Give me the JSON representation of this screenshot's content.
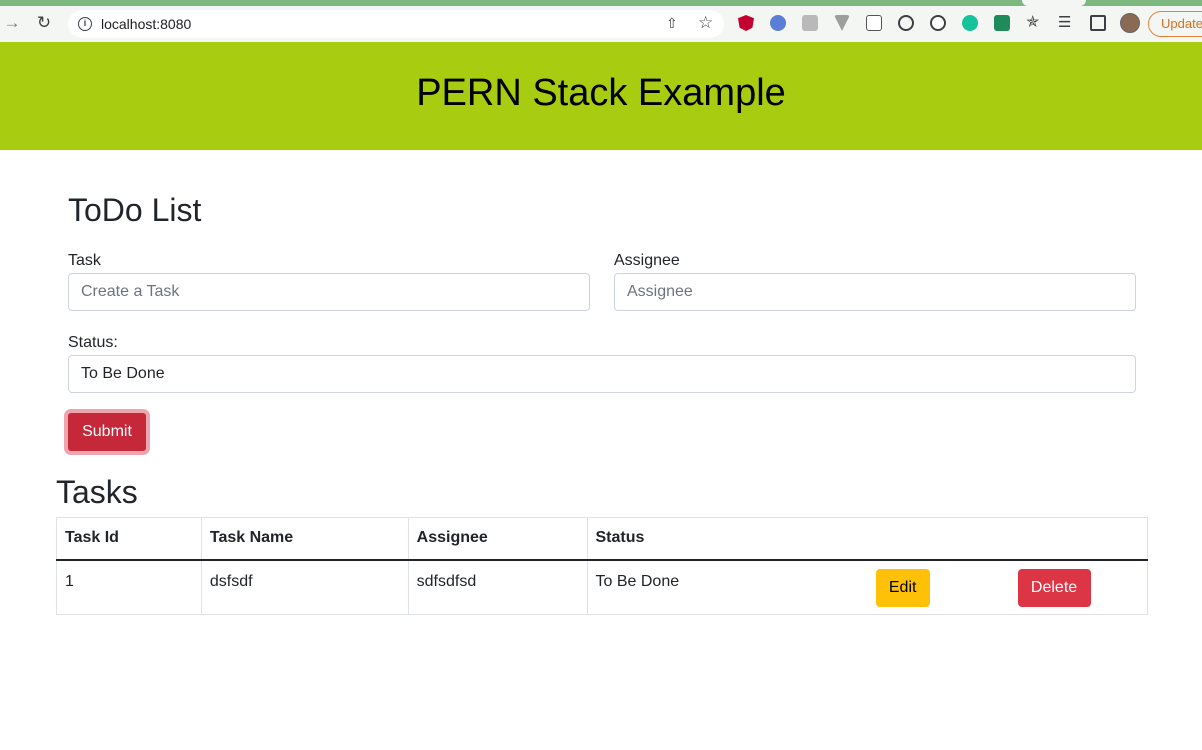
{
  "browser": {
    "url": "localhost:8080",
    "update_label": "Update"
  },
  "header": {
    "title": "PERN Stack Example"
  },
  "form": {
    "title": "ToDo List",
    "task_label": "Task",
    "task_placeholder": "Create a Task",
    "assignee_label": "Assignee",
    "assignee_placeholder": "Assignee",
    "status_label": "Status:",
    "status_value": "To Be Done",
    "submit_label": "Submit"
  },
  "tasks": {
    "title": "Tasks",
    "columns": [
      "Task Id",
      "Task Name",
      "Assignee",
      "Status"
    ],
    "rows": [
      {
        "id": "1",
        "name": "dsfsdf",
        "assignee": "sdfsdfsd",
        "status": "To Be Done",
        "edit_label": "Edit",
        "delete_label": "Delete"
      }
    ]
  },
  "colors": {
    "header_bg": "#a8cc0f",
    "submit_bg": "#c52838",
    "edit_bg": "#ffc107",
    "delete_bg": "#dc3545"
  }
}
